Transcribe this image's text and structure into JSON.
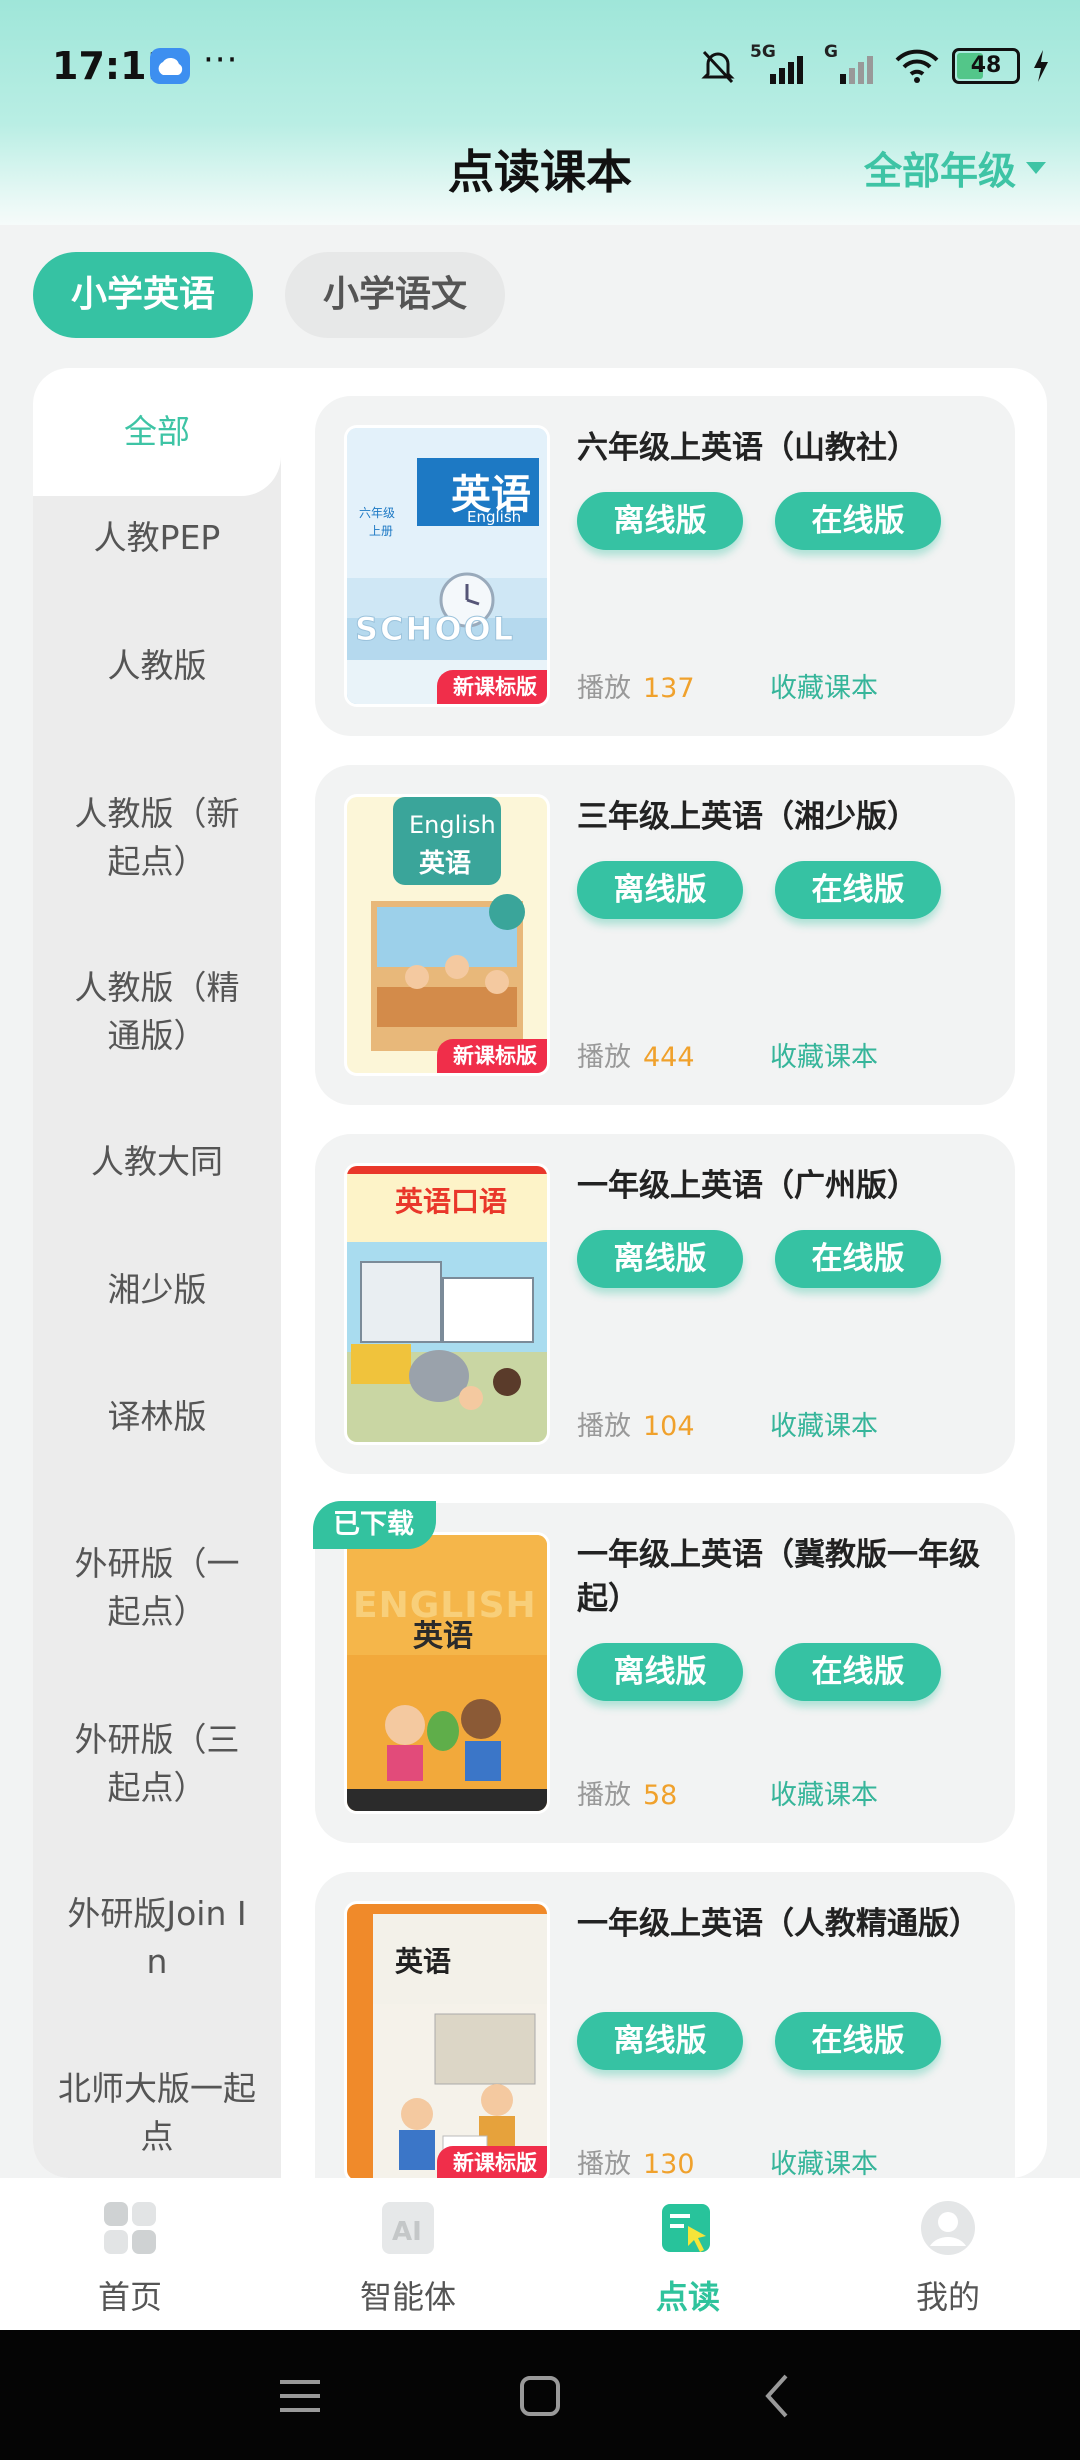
{
  "status": {
    "time": "17:11",
    "more": "···",
    "signal_5g": "5G",
    "signal_g": "G",
    "battery": "48"
  },
  "header": {
    "title": "点读课本",
    "grade_filter": "全部年级"
  },
  "subject_tabs": [
    "小学英语",
    "小学语文"
  ],
  "sidebar": {
    "items": [
      "全部",
      "人教PEP",
      "人教版",
      "人教版（新起点）",
      "人教版（精通版）",
      "人教大同",
      "湘少版",
      "译林版",
      "外研版（一起点）",
      "外研版（三起点）",
      "外研版Join In",
      "北师大版一起点"
    ]
  },
  "cover_text": {
    "c1_title": "英语",
    "c1_sub": "English",
    "c1_grade": "六年级",
    "c1_term": "上册",
    "c1_word": "SCHOOL",
    "c2_title": "English",
    "c2_sub": "英语",
    "c3_title": "英语口语",
    "c4_title": "ENGLISH",
    "c4_sub": "英语",
    "c5_title": "英语"
  },
  "books": [
    {
      "title": "六年级上英语（山教社）",
      "offline": "离线版",
      "online": "在线版",
      "play_label": "播放",
      "plays": "137",
      "fav": "收藏课本",
      "tag": "新课标版",
      "downloaded": ""
    },
    {
      "title": "三年级上英语（湘少版）",
      "offline": "离线版",
      "online": "在线版",
      "play_label": "播放",
      "plays": "444",
      "fav": "收藏课本",
      "tag": "新课标版",
      "downloaded": ""
    },
    {
      "title": "一年级上英语（广州版）",
      "offline": "离线版",
      "online": "在线版",
      "play_label": "播放",
      "plays": "104",
      "fav": "收藏课本",
      "tag": "",
      "downloaded": ""
    },
    {
      "title": "一年级上英语（冀教版一年级起）",
      "offline": "离线版",
      "online": "在线版",
      "play_label": "播放",
      "plays": "58",
      "fav": "收藏课本",
      "tag": "",
      "downloaded": "已下载"
    },
    {
      "title": "一年级上英语（人教精通版）",
      "offline": "离线版",
      "online": "在线版",
      "play_label": "播放",
      "plays": "130",
      "fav": "收藏课本",
      "tag": "新课标版",
      "downloaded": ""
    }
  ],
  "bottom_nav": [
    "首页",
    "智能体",
    "点读",
    "我的"
  ],
  "colors": {
    "accent": "#36c2a3",
    "play_count": "#f0a12c",
    "new_badge": "#f02e4a"
  }
}
